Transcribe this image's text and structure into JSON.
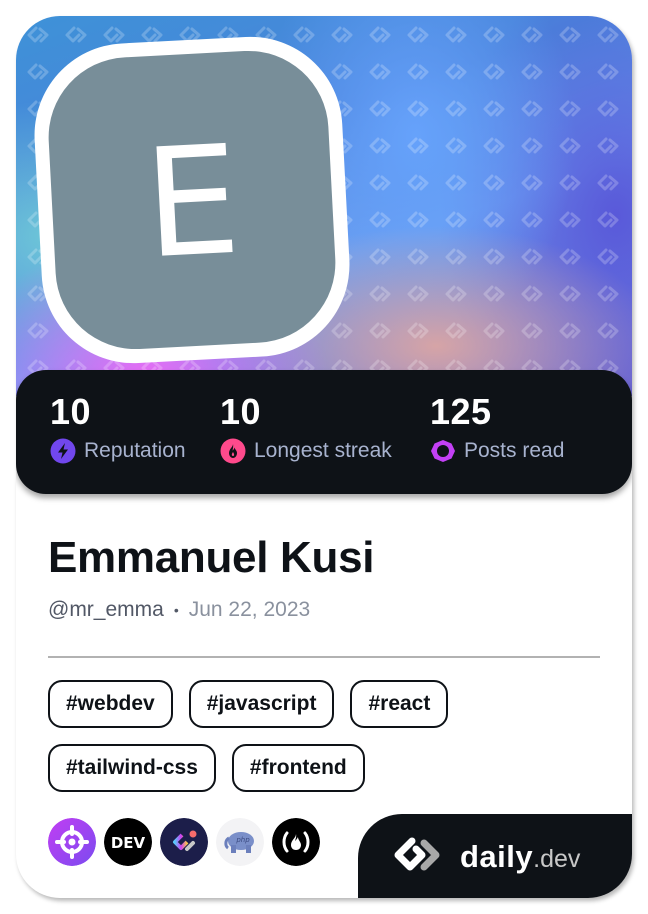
{
  "cover": {
    "avatar_initial": "E",
    "avatar_color": "#788e99"
  },
  "stats": [
    {
      "value": "10",
      "label": "Reputation",
      "icon": "lightning-icon",
      "color": "#7147ed"
    },
    {
      "value": "10",
      "label": "Longest streak",
      "icon": "flame-icon",
      "color": "#ff4a8c"
    },
    {
      "value": "125",
      "label": "Posts read",
      "icon": "ring-icon",
      "color": "#c340f5"
    }
  ],
  "profile": {
    "name": "Emmanuel Kusi",
    "username": "@mr_emma",
    "separator": "•",
    "joined": "Jun 22, 2023"
  },
  "tags": [
    "#webdev",
    "#javascript",
    "#react",
    "#tailwind-css",
    "#frontend"
  ],
  "sources": [
    {
      "name": "crosshair-source",
      "label": "Target"
    },
    {
      "name": "dev-source",
      "label": "DEV"
    },
    {
      "name": "dailydev-community-source",
      "label": "daily.dev community"
    },
    {
      "name": "php-source",
      "label": "php"
    },
    {
      "name": "freecodecamp-source",
      "label": "freeCodeCamp"
    }
  ],
  "brand": {
    "word": "daily",
    "tld": ".dev"
  }
}
